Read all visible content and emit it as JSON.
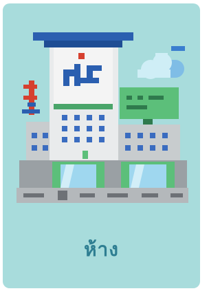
{
  "card": {
    "illustration_icon": "department-store-building-icon",
    "word": "ห้าง"
  },
  "colors": {
    "card_background": "#a8dcdc",
    "word_text": "#2e7e92",
    "roof_blue": "#2b5fb0",
    "tower_white": "#f2f2f2",
    "building_gray": "#c8ccce",
    "window_blue": "#3a6cc0",
    "sign_green": "#5cbf7a",
    "glass_blue": "#9fd7ef",
    "road_gray": "#8c8f93",
    "cloud": "#7fbde6"
  }
}
